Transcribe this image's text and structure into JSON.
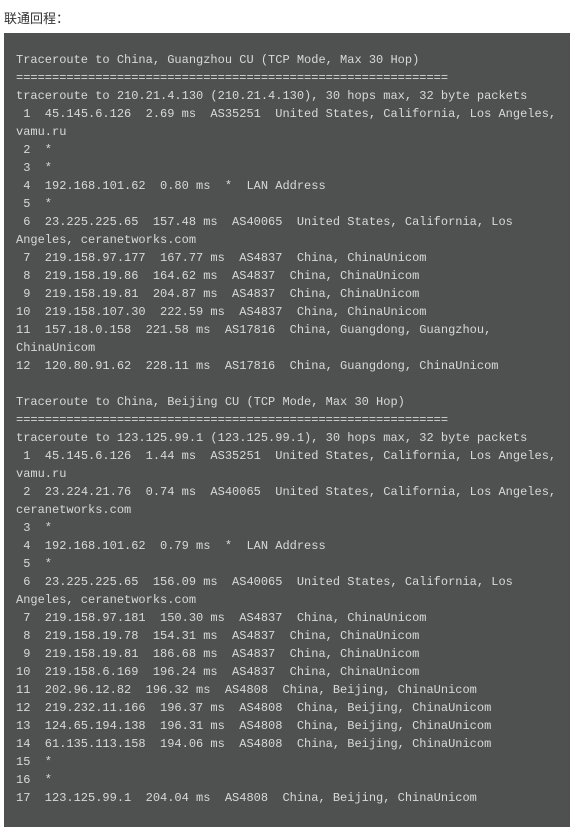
{
  "title": "联通回程：",
  "terminal_lines": [
    "Traceroute to China, Guangzhou CU (TCP Mode, Max 30 Hop)",
    "============================================================",
    "traceroute to 210.21.4.130 (210.21.4.130), 30 hops max, 32 byte packets",
    " 1  45.145.6.126  2.69 ms  AS35251  United States, California, Los Angeles, vamu.ru",
    " 2  *",
    " 3  *",
    " 4  192.168.101.62  0.80 ms  *  LAN Address",
    " 5  *",
    " 6  23.225.225.65  157.48 ms  AS40065  United States, California, Los Angeles, ceranetworks.com",
    " 7  219.158.97.177  167.77 ms  AS4837  China, ChinaUnicom",
    " 8  219.158.19.86  164.62 ms  AS4837  China, ChinaUnicom",
    " 9  219.158.19.81  204.87 ms  AS4837  China, ChinaUnicom",
    "10  219.158.107.30  222.59 ms  AS4837  China, ChinaUnicom",
    "11  157.18.0.158  221.58 ms  AS17816  China, Guangdong, Guangzhou, ChinaUnicom",
    "12  120.80.91.62  228.11 ms  AS17816  China, Guangdong, ChinaUnicom",
    "",
    "Traceroute to China, Beijing CU (TCP Mode, Max 30 Hop)",
    "============================================================",
    "traceroute to 123.125.99.1 (123.125.99.1), 30 hops max, 32 byte packets",
    " 1  45.145.6.126  1.44 ms  AS35251  United States, California, Los Angeles, vamu.ru",
    " 2  23.224.21.76  0.74 ms  AS40065  United States, California, Los Angeles, ceranetworks.com",
    " 3  *",
    " 4  192.168.101.62  0.79 ms  *  LAN Address",
    " 5  *",
    " 6  23.225.225.65  156.09 ms  AS40065  United States, California, Los Angeles, ceranetworks.com",
    " 7  219.158.97.181  150.30 ms  AS4837  China, ChinaUnicom",
    " 8  219.158.19.78  154.31 ms  AS4837  China, ChinaUnicom",
    " 9  219.158.19.81  186.68 ms  AS4837  China, ChinaUnicom",
    "10  219.158.6.169  196.24 ms  AS4837  China, ChinaUnicom",
    "11  202.96.12.82  196.32 ms  AS4808  China, Beijing, ChinaUnicom",
    "12  219.232.11.166  196.37 ms  AS4808  China, Beijing, ChinaUnicom",
    "13  124.65.194.138  196.31 ms  AS4808  China, Beijing, ChinaUnicom",
    "14  61.135.113.158  194.06 ms  AS4808  China, Beijing, ChinaUnicom",
    "15  *",
    "16  *",
    "17  123.125.99.1  204.04 ms  AS4808  China, Beijing, ChinaUnicom"
  ]
}
